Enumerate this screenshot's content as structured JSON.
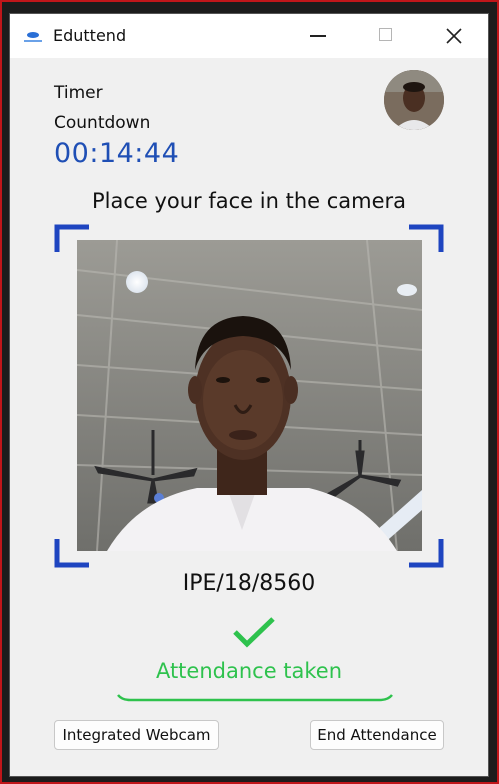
{
  "window": {
    "title": "Eduttend",
    "controls": {
      "minimize_icon": "minimize-icon",
      "maximize_icon": "maximize-icon",
      "close_icon": "close-icon"
    }
  },
  "timer": {
    "label_line1": "Timer",
    "label_line2": "Countdown",
    "value": "00:14:44"
  },
  "camera": {
    "instruction": "Place your face in the camera",
    "frame_color": "#1e45c0"
  },
  "student": {
    "id": "IPE/18/8560"
  },
  "status": {
    "icon": "checkmark-icon",
    "text": "Attendance taken",
    "color": "#2ec24d"
  },
  "buttons": {
    "webcam_label": "Integrated Webcam",
    "end_label": "End Attendance"
  },
  "colors": {
    "timer": "#1f4fb5",
    "accent_blue": "#1e45c0",
    "success_green": "#2ec24d"
  }
}
